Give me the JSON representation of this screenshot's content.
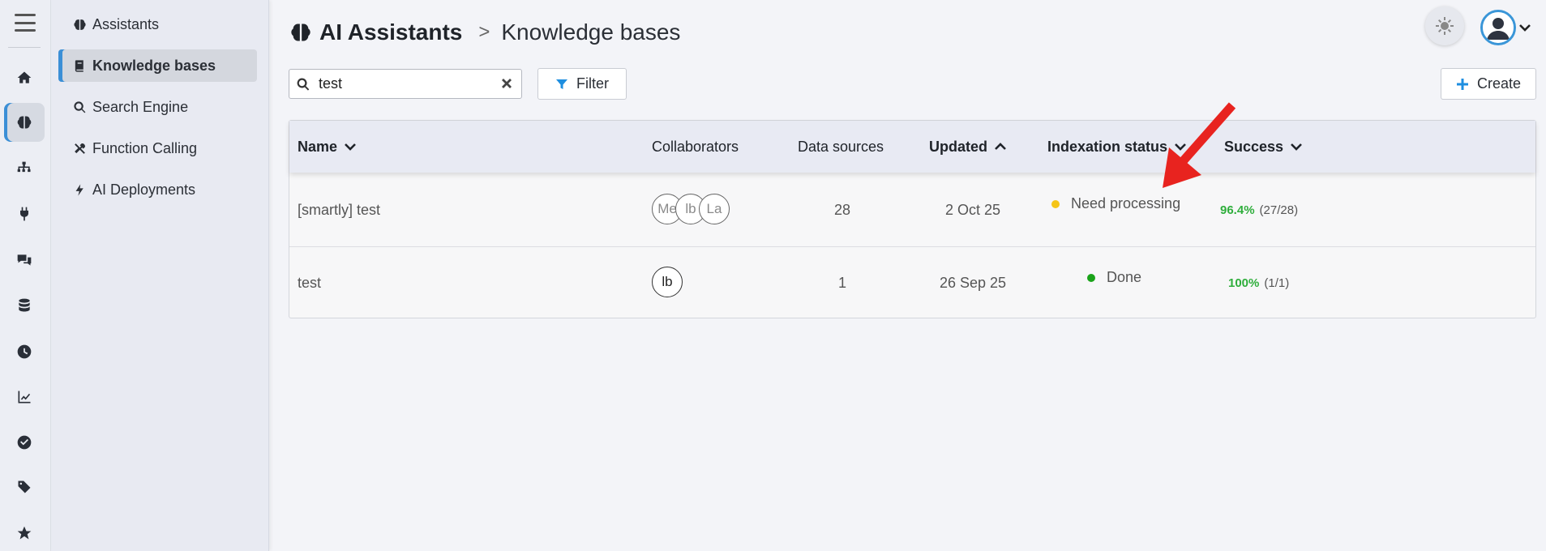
{
  "header": {
    "root": "AI Assistants",
    "separator": ">",
    "current": "Knowledge bases"
  },
  "rail": {
    "icons": [
      "menu-icon",
      "home-icon",
      "brain-icon",
      "sitemap-icon",
      "plug-icon",
      "comments-icon",
      "database-icon",
      "clock-icon",
      "chart-line-icon",
      "check-circle-icon",
      "tag-icon",
      "star-icon"
    ],
    "active": "brain-icon"
  },
  "subnav": {
    "items": [
      {
        "label": "Assistants",
        "icon": "brain-icon"
      },
      {
        "label": "Knowledge bases",
        "icon": "book-icon",
        "active": true
      },
      {
        "label": "Search Engine",
        "icon": "search-icon"
      },
      {
        "label": "Function Calling",
        "icon": "tools-icon"
      },
      {
        "label": "AI Deployments",
        "icon": "bolt-icon"
      }
    ]
  },
  "toolbar": {
    "search_value": "test",
    "filter_label": "Filter",
    "create_label": "Create"
  },
  "table": {
    "columns": {
      "name": "Name",
      "collaborators": "Collaborators",
      "data_sources": "Data sources",
      "updated": "Updated",
      "status": "Indexation status",
      "success": "Success"
    },
    "rows": [
      {
        "name": "[smartly] test",
        "collaborators": [
          "Me",
          "lb",
          "La"
        ],
        "data_sources": "28",
        "updated": "2 Oct 25",
        "status": "Need processing",
        "status_color": "#f5c518",
        "success_pct": "96.4%",
        "success_frac": "(27/28)"
      },
      {
        "name": "test",
        "collaborators": [
          "lb"
        ],
        "data_sources": "1",
        "updated": "26 Sep 25",
        "status": "Done",
        "status_color": "#1aa31a",
        "success_pct": "100%",
        "success_frac": "(1/1)"
      }
    ]
  },
  "colors": {
    "accent": "#3b8fd6",
    "success_text": "#2fae3c",
    "annotation_arrow": "#e8231f"
  }
}
